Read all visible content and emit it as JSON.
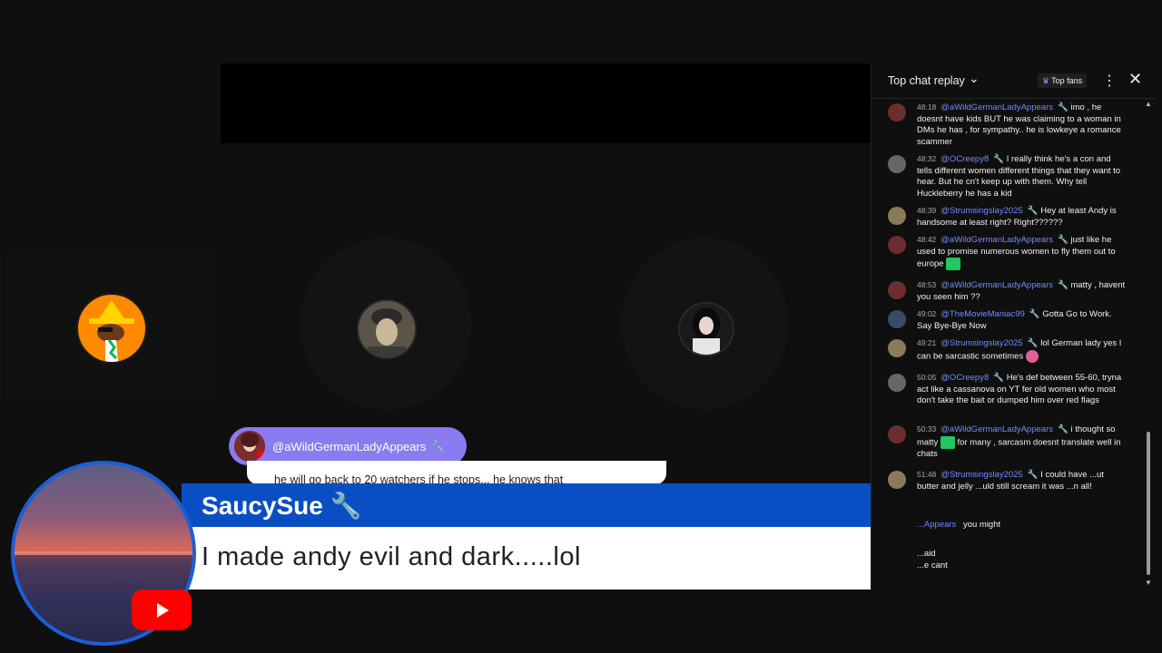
{
  "chat": {
    "header_title": "Top chat replay",
    "top_fans_label": "Top fans",
    "messages": [
      {
        "time": "48:18",
        "author": "@aWildGermanLadyAppears",
        "text": "imo , he doesnt have kids BUT he was claiming to a woman in DMs he has , for sympathy.. he is lowkeye a romance scammer"
      },
      {
        "time": "48:32",
        "author": "@OCreepy8",
        "text": "I really think he's a con and tells different women different things that they want to hear. But he cn't keep up with them. Why tell Huckleberry he has a kid"
      },
      {
        "time": "48:39",
        "author": "@Strumsingslay2025",
        "text": "Hey at least Andy is handsome at least right? Right??????"
      },
      {
        "time": "48:42",
        "author": "@aWildGermanLadyAppears",
        "text": "just like he used to promise numerous women to fly them out to europe"
      },
      {
        "time": "48:53",
        "author": "@aWildGermanLadyAppears",
        "text": "matty , havent you seen him ??"
      },
      {
        "time": "49:02",
        "author": "@TheMovieManiac99",
        "text": "Gotta Go to Work. Say Bye-Bye Now"
      },
      {
        "time": "49:21",
        "author": "@Strumsingslay2025",
        "text": "lol German lady yes I can be sarcastic sometimes"
      },
      {
        "time": "50:05",
        "author": "@OCreepy8",
        "text": "He's def between 55-60, tryna act like a cassanova on YT fer old women who most don't take the bait or dumped him over red flags"
      },
      {
        "time": "50:33",
        "author": "@aWildGermanLadyAppears",
        "text1": "i thought so matty",
        "text2": "for many , sarcasm doesnt translate well in chats"
      },
      {
        "time": "51:48",
        "author": "@Strumsingslay2025",
        "text": "I could have ...ut butter and jelly ...uld still scream it was ...n all!"
      }
    ],
    "partial_author_1": "...Appears",
    "partial_text_1": "you might",
    "partial_text_2": "...aid",
    "partial_text_3": "...e cant"
  },
  "overlay": {
    "pill_name": "@aWildGermanLadyAppears",
    "pill_message": "he will go back to 20 watchers if he stops... he knows that"
  },
  "lower_third": {
    "name": "SaucySue",
    "message": "I made andy evil and dark.....lol"
  },
  "colors": {
    "blue": "#0a4ec4",
    "pill": "#8a7bf0",
    "author": "#6f8cff",
    "youtube_red": "#ff0000"
  }
}
